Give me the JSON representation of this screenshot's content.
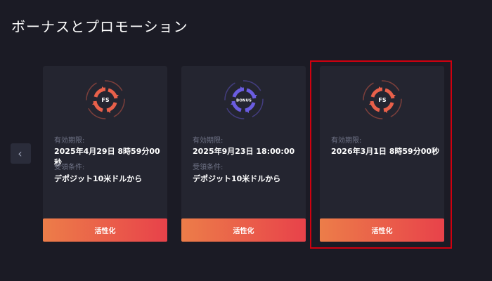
{
  "page": {
    "title": "ボーナスとプロモーション"
  },
  "carousel": {
    "prev_icon": "chevron-left-icon",
    "prev_glyph": "‹"
  },
  "colors": {
    "fs_accent": "#e8604a",
    "bonus_accent": "#6a5ce0",
    "button_gradient": [
      "#ec7d49",
      "#e8424a"
    ],
    "highlight": "#d0000f"
  },
  "cards": [
    {
      "icon": "free-spins-icon",
      "badge": "FS",
      "expiry_label": "有効期限:",
      "expiry_value": "2025年4月29日 8時59分00秒",
      "condition_label": "受領条件:",
      "condition_value": "デポジット10米ドルから",
      "button_label": "活性化"
    },
    {
      "icon": "bonus-icon",
      "badge": "BONUS",
      "expiry_label": "有効期限:",
      "expiry_value": "2025年9月23日 18:00:00",
      "condition_label": "受領条件:",
      "condition_value": "デポジット10米ドルから",
      "button_label": "活性化"
    },
    {
      "icon": "free-spins-icon",
      "badge": "FS",
      "expiry_label": "有効期限:",
      "expiry_value": "2026年3月1日 8時59分00秒",
      "button_label": "活性化",
      "highlighted": true
    }
  ]
}
